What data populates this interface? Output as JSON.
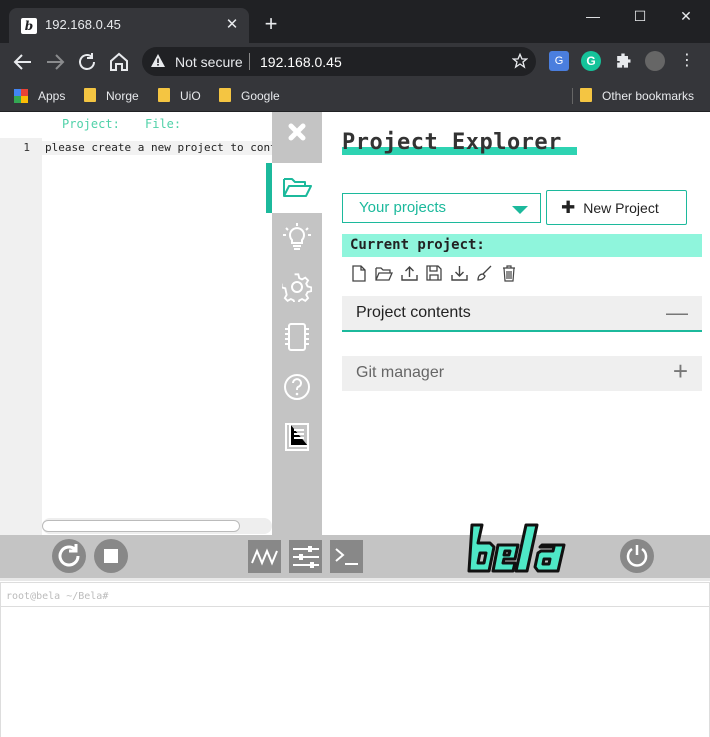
{
  "browser": {
    "tab_title": "192.168.0.45",
    "tab_favicon": "b",
    "omnibox": {
      "security": "Not secure",
      "url": "192.168.0.45"
    },
    "bookmarks": [
      {
        "label": "Apps",
        "icon": "apps-grid-icon"
      },
      {
        "label": "Norge",
        "icon": "folder-icon"
      },
      {
        "label": "UiO",
        "icon": "folder-icon"
      },
      {
        "label": "Google",
        "icon": "folder-icon"
      }
    ],
    "other_bookmarks": "Other bookmarks"
  },
  "editor": {
    "project_label": "Project:",
    "file_label": "File:",
    "line_number": "1",
    "code_text": "please create a new project to continue"
  },
  "explorer": {
    "title": "Project Explorer",
    "projects_select": "Your projects",
    "new_project": "New Project",
    "current_project": "Current project:",
    "sections": [
      {
        "label": "Project contents",
        "state": "expanded"
      },
      {
        "label": "Git manager",
        "state": "collapsed"
      }
    ]
  },
  "colors": {
    "accent": "#1cb99c",
    "accent_light": "#8ff5dc",
    "panel_gray": "#c4c4c4",
    "chrome_dark": "#202124",
    "chrome_toolbar": "#35363a"
  },
  "console": {
    "prompt": "root@bela ~/Bela#"
  }
}
